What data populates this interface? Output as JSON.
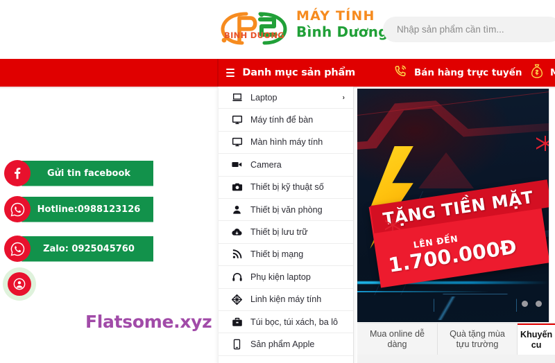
{
  "header": {
    "logo": {
      "badge": "BINH DUONG",
      "line1": "MÁY TÍNH",
      "line2": "Bình Dương"
    },
    "search": {
      "placeholder": "Nhập sản phẩm cần tìm...",
      "value": ""
    }
  },
  "navbar": {
    "category_toggle_label": "Danh mục sản phẩm",
    "items": [
      {
        "label": "Bán hàng trực tuyến",
        "icon": "phone-ring-icon"
      },
      {
        "label": "M",
        "icon": "money-bag-icon"
      }
    ]
  },
  "category_menu": {
    "items": [
      {
        "label": "Laptop",
        "icon": "laptop-icon",
        "has_submenu": true,
        "arrow": "›"
      },
      {
        "label": "Máy tính để bàn",
        "icon": "desktop-icon",
        "has_submenu": false
      },
      {
        "label": "Màn hình máy tính",
        "icon": "monitor-icon",
        "has_submenu": false
      },
      {
        "label": "Camera",
        "icon": "video-camera-icon",
        "has_submenu": false
      },
      {
        "label": "Thiết bị kỹ thuật số",
        "icon": "photo-camera-icon",
        "has_submenu": false
      },
      {
        "label": "Thiết bị văn phòng",
        "icon": "person-icon",
        "has_submenu": false
      },
      {
        "label": "Thiết bị lưu trữ",
        "icon": "cloud-download-icon",
        "has_submenu": false
      },
      {
        "label": "Thiết bị mạng",
        "icon": "wifi-signal-icon",
        "has_submenu": false
      },
      {
        "label": "Phụ kiện laptop",
        "icon": "headphones-icon",
        "has_submenu": false
      },
      {
        "label": "Linh kiện máy tính",
        "icon": "cube-icon",
        "has_submenu": false
      },
      {
        "label": "Túi bọc, túi xách, ba lô",
        "icon": "briefcase-icon",
        "has_submenu": false
      },
      {
        "label": "Sản phẩm Apple",
        "icon": "mobile-phone-icon",
        "has_submenu": false
      }
    ]
  },
  "banner": {
    "headline": "TẶNG TIỀN MẶT",
    "subline": "LÊN ĐẾN",
    "amount": "1.700.000Đ",
    "dots": [
      "dot-1",
      "dot-2"
    ]
  },
  "tabs": [
    {
      "label": "Mua online dễ dàng",
      "active": false
    },
    {
      "label": "Quà tặng mùa tựu trường",
      "active": false
    },
    {
      "label": "Khuyến\ncu",
      "active": true
    }
  ],
  "contact_widgets": [
    {
      "label": "Gửi tin facebook",
      "icon": "facebook-icon"
    },
    {
      "label": "Hotline:0988123126",
      "icon": "whatsapp-icon"
    },
    {
      "label": "Zalo: 0925045760",
      "icon": "whatsapp-icon"
    }
  ],
  "contact_fab": {
    "icon": "account-circle-icon"
  },
  "watermark": {
    "text": "Flatsome.xyz"
  },
  "colors": {
    "brand_red": "#E00000",
    "accent_red": "#E8112D",
    "brand_green": "#12924B",
    "logo_orange": "#F68B1F",
    "logo_green": "#21A038",
    "watermark_purple": "#A14BA8"
  }
}
